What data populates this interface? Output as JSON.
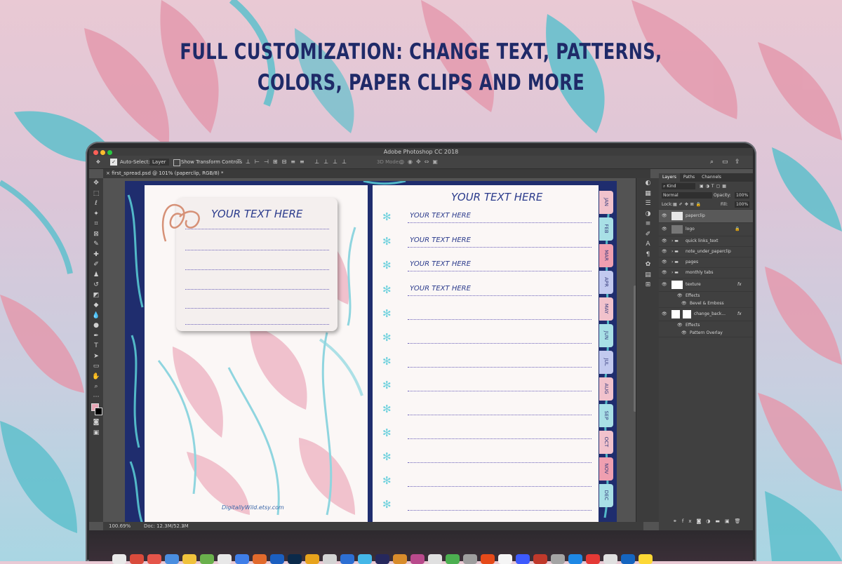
{
  "headline": {
    "line1": "FULL CUSTOMIZATION: CHANGE TEXT, PATTERNS,",
    "line2": "COLORS, PAPER CLIPS AND MORE"
  },
  "colors": {
    "headline": "#1f2a68",
    "pink": "#e8a7b7",
    "teal": "#5fc6d2",
    "navy": "#1f2d6e"
  },
  "photoshop": {
    "window_title": "Adobe Photoshop CC 2018",
    "doc_tab": "first_spread.psd @ 101% (paperclip, RGB/8) *",
    "options": {
      "auto_select_label": "Auto-Select:",
      "auto_select_value": "Layer",
      "transform_label": "Show Transform Controls",
      "mode_3d": "3D Mode:"
    },
    "status": {
      "zoom": "100.69%",
      "doc": "Doc: 12.3M/52.3M"
    },
    "layers_panel": {
      "tabs": [
        "Layers",
        "Paths",
        "Channels"
      ],
      "kind": "Kind",
      "blend_mode": "Normal",
      "opacity_label": "Opacity:",
      "opacity_value": "100%",
      "lock_label": "Lock:",
      "fill_label": "Fill:",
      "fill_value": "100%",
      "layers": [
        {
          "name": "paperclip",
          "type": "layer",
          "selected": true
        },
        {
          "name": "logo",
          "type": "layer",
          "locked": true
        },
        {
          "name": "quick links_text",
          "type": "group"
        },
        {
          "name": "note_under_paperclip",
          "type": "group"
        },
        {
          "name": "pages",
          "type": "group"
        },
        {
          "name": "monthly tabs",
          "type": "group"
        },
        {
          "name": "texture",
          "type": "layer",
          "fx": true
        },
        {
          "name": "Effects",
          "type": "effects"
        },
        {
          "name": "Bevel & Emboss",
          "type": "effect"
        },
        {
          "name": "change_back...",
          "type": "layer",
          "fx": true
        },
        {
          "name": "Effects",
          "type": "effects"
        },
        {
          "name": "Pattern Overlay",
          "type": "effect"
        }
      ]
    }
  },
  "notebook": {
    "card_title": "YOUR TEXT HERE",
    "right_title": "YOUR TEXT HERE",
    "entries": [
      "YOUR TEXT HERE",
      "YOUR TEXT HERE",
      "YOUR TEXT HERE",
      "YOUR TEXT HERE"
    ],
    "watermark": "DigitallyWild.etsy.com",
    "months": [
      "JAN",
      "FEB",
      "MAR",
      "APR",
      "MAY",
      "JUN",
      "JUL",
      "AUG",
      "SEP",
      "OCT",
      "NOV",
      "DEC"
    ]
  }
}
